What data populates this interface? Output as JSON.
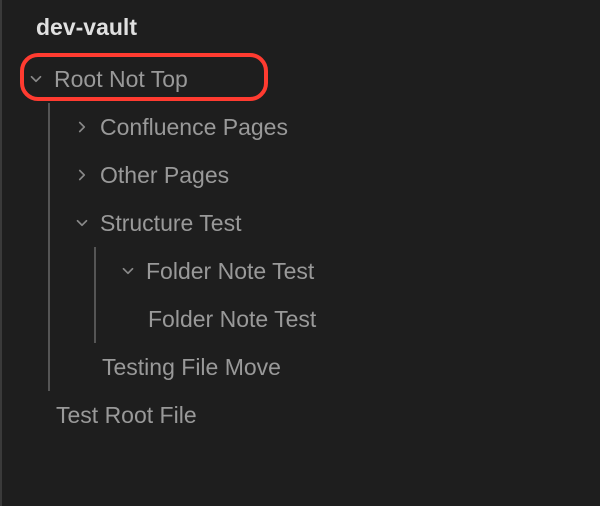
{
  "vault": {
    "name": "dev-vault"
  },
  "tree": {
    "root": {
      "label": "Root Not Top",
      "expanded": true,
      "highlighted": true
    },
    "items": [
      {
        "label": "Confluence Pages",
        "expanded": false
      },
      {
        "label": "Other Pages",
        "expanded": false
      },
      {
        "label": "Structure Test",
        "expanded": true
      },
      {
        "label": "Folder Note Test",
        "expanded": true,
        "depth": 2
      },
      {
        "label": "Folder Note Test",
        "leaf": true,
        "depth": 3
      },
      {
        "label": "Testing File Move",
        "leaf": true,
        "depth": 2
      },
      {
        "label": "Test Root File",
        "leaf": true,
        "depth": 1
      }
    ]
  }
}
